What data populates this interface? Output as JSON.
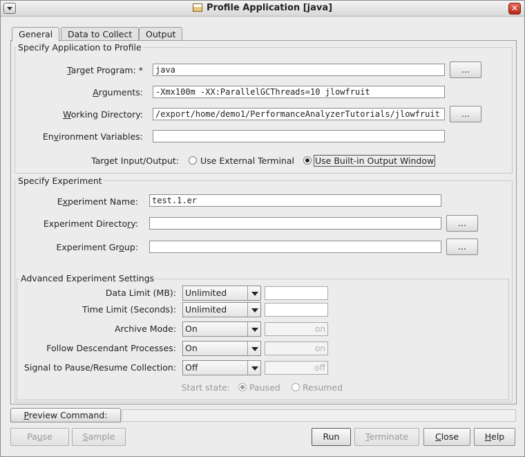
{
  "window": {
    "title": "Profile Application [java]",
    "close_glyph": "✕"
  },
  "tabs": [
    {
      "label": "General",
      "active": true
    },
    {
      "label": "Data to Collect",
      "active": false
    },
    {
      "label": "Output",
      "active": false
    }
  ],
  "application": {
    "section_title": "Specify Application to Profile",
    "target_program": {
      "label_pre": "",
      "label_u": "T",
      "label_post": "arget Program: *",
      "value": "java"
    },
    "arguments": {
      "label_pre": "",
      "label_u": "A",
      "label_post": "rguments:",
      "value": "-Xmx100m -XX:ParallelGCThreads=10 jlowfruit"
    },
    "working_directory": {
      "label_pre": "",
      "label_u": "W",
      "label_post": "orking Directory:",
      "value": "/export/home/demo1/PerformanceAnalyzerTutorials/jlowfruit"
    },
    "environment_variables": {
      "label_pre": "En",
      "label_u": "v",
      "label_post": "ironment Variables:",
      "value": ""
    },
    "target_io": {
      "label": "Target Input/Output:",
      "options": [
        {
          "label": "Use External Terminal",
          "selected": false
        },
        {
          "label": "Use Built-in Output Window",
          "selected": true
        }
      ]
    },
    "browse_label": "..."
  },
  "experiment": {
    "section_title": "Specify Experiment",
    "name": {
      "label_pre": "E",
      "label_u": "x",
      "label_post": "periment Name:",
      "value": "test.1.er"
    },
    "directory": {
      "label_pre": "Experiment Directo",
      "label_u": "r",
      "label_post": "y:",
      "value": ""
    },
    "group": {
      "label_pre": "Experiment Gr",
      "label_u": "o",
      "label_post": "up:",
      "value": ""
    },
    "browse_label": "..."
  },
  "advanced": {
    "section_title": "Advanced Experiment Settings",
    "rows": [
      {
        "label": "Data Limit (MB):",
        "value": "Unlimited",
        "field": "",
        "field_enabled": true
      },
      {
        "label": "Time Limit (Seconds):",
        "value": "Unlimited",
        "field": "",
        "field_enabled": true
      },
      {
        "label": "Archive Mode:",
        "value": "On",
        "field": "on",
        "field_enabled": false
      },
      {
        "label": "Follow Descendant Processes:",
        "value": "On",
        "field": "on",
        "field_enabled": false
      },
      {
        "label": "Signal to Pause/Resume Collection:",
        "value": "Off",
        "field": "off",
        "field_enabled": false
      }
    ],
    "start_state": {
      "label": "Start state:",
      "options": [
        {
          "label": "Paused",
          "selected": true
        },
        {
          "label": "Resumed",
          "selected": false
        }
      ]
    }
  },
  "preview": {
    "label_pre": "",
    "label_u": "P",
    "label_post": "review Command:"
  },
  "footer": {
    "pause": {
      "pre": "Pa",
      "u": "u",
      "post": "se"
    },
    "sample": {
      "pre": "",
      "u": "S",
      "post": "ample"
    },
    "run": {
      "label": "Run"
    },
    "terminate": {
      "pre": "",
      "u": "T",
      "post": "erminate"
    },
    "close": {
      "pre": "",
      "u": "C",
      "post": "lose"
    },
    "help": {
      "pre": "",
      "u": "H",
      "post": "elp"
    }
  }
}
